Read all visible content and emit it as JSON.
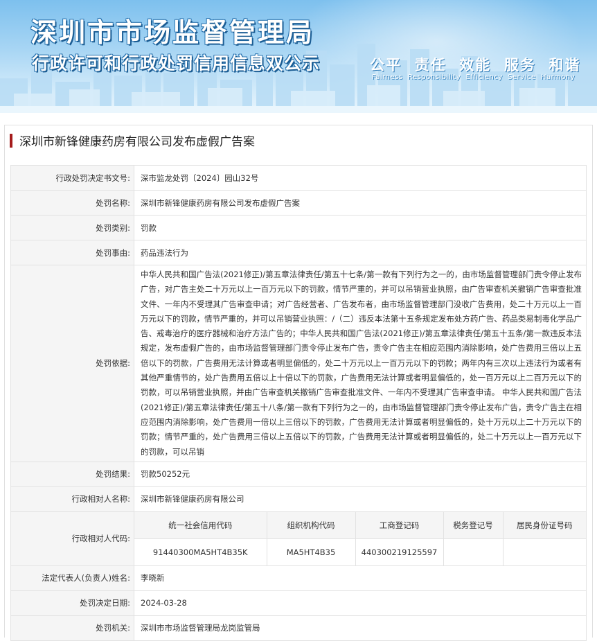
{
  "banner": {
    "title": "深圳市市场监督管理局",
    "subtitle": "行政许可和行政处罚信用信息双公示",
    "slogan": "公平  责任  效能  服务  和谐",
    "slogan_en": "Fairness  Responsibility  Efficiency  Service  Harmony"
  },
  "case_title": "深圳市新锋健康药房有限公司发布虚假广告案",
  "rows": {
    "decision_no": {
      "label": "行政处罚决定书文号:",
      "value": "深市监龙处罚〔2024〕园山32号"
    },
    "penalty_name": {
      "label": "处罚名称:",
      "value": "深圳市新锋健康药房有限公司发布虚假广告案"
    },
    "penalty_type": {
      "label": "处罚类别:",
      "value": "罚款"
    },
    "penalty_reason": {
      "label": "处罚事由:",
      "value": "药品违法行为"
    },
    "penalty_basis": {
      "label": "处罚依据:",
      "value": "中华人民共和国广告法(2021修正)/第五章法律责任/第五十七条/第一款有下列行为之一的，由市场监督管理部门责令停止发布广告，对广告主处二十万元以上一百万元以下的罚款，情节严重的，并可以吊销营业执照，由广告审查机关撤销广告审查批准文件、一年内不受理其广告审查申请；对广告经营者、广告发布者，由市场监督管理部门没收广告费用，处二十万元以上一百万元以下的罚款，情节严重的，并可以吊销营业执照：/（二）违反本法第十五条规定发布处方药广告、药品类易制毒化学品广告、戒毒治疗的医疗器械和治疗方法广告的；中华人民共和国广告法(2021修正)/第五章法律责任/第五十五条/第一款违反本法规定，发布虚假广告的，由市场监督管理部门责令停止发布广告，责令广告主在相应范围内消除影响，处广告费用三倍以上五倍以下的罚款，广告费用无法计算或者明显偏低的，处二十万元以上一百万元以下的罚款；两年内有三次以上违法行为或者有其他严重情节的，处广告费用五倍以上十倍以下的罚款，广告费用无法计算或者明显偏低的，处一百万元以上二百万元以下的罚款，可以吊销营业执照，并由广告审查机关撤销广告审查批准文件、一年内不受理其广告审查申请。 中华人民共和国广告法(2021修正)/第五章法律责任/第五十八条/第一款有下列行为之一的，由市场监督管理部门责令停止发布广告，责令广告主在相应范围内消除影响，处广告费用一倍以上三倍以下的罚款，广告费用无法计算或者明显偏低的，处十万元以上二十万元以下的罚款；情节严重的，处广告费用三倍以上五倍以下的罚款，广告费用无法计算或者明显偏低的，处二十万元以上一百万元以下的罚款，可以吊销"
    },
    "penalty_result": {
      "label": "处罚结果:",
      "value": "罚款50252元"
    },
    "party_name": {
      "label": "行政相对人名称:",
      "value": "深圳市新锋健康药房有限公司"
    },
    "party_code": {
      "label": "行政相对人代码:",
      "headers": [
        "统一社会信用代码",
        "组织机构代码",
        "工商登记码",
        "税务登记号",
        "居民身份证号码"
      ],
      "values": [
        "91440300MA5HT4B35K",
        "MA5HT4B35",
        "440300219125597",
        "",
        ""
      ]
    },
    "legal_rep": {
      "label": "法定代表人(负责人)姓名:",
      "value": "李晓新"
    },
    "decision_date": {
      "label": "处罚决定日期:",
      "value": "2024-03-28"
    },
    "authority": {
      "label": "处罚机关:",
      "value": "深圳市市场监督管理局龙岗监管局"
    }
  }
}
